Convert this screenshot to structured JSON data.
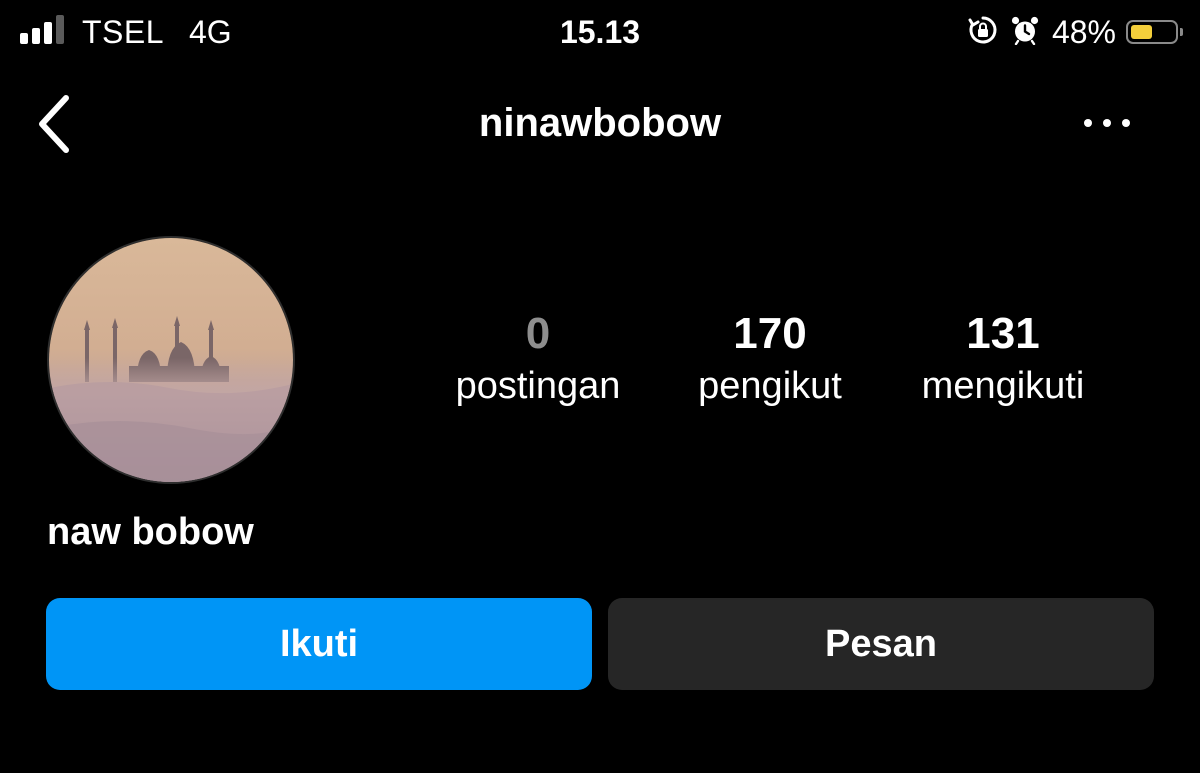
{
  "status_bar": {
    "carrier": "TSEL",
    "network": "4G",
    "time": "15.13",
    "battery_percent_label": "48%",
    "battery_level": 0.48,
    "battery_color": "#f4cf3b",
    "icons": [
      "signal-icon",
      "rotation-lock-icon",
      "alarm-icon",
      "battery-icon"
    ]
  },
  "header": {
    "username": "ninawbobow",
    "back_icon": "chevron-left-icon",
    "more_icon": "more-horizontal-icon"
  },
  "profile": {
    "display_name": "naw bobow",
    "stats": {
      "posts": {
        "value": "0",
        "label": "postingan"
      },
      "followers": {
        "value": "170",
        "label": "pengikut"
      },
      "following": {
        "value": "131",
        "label": "mengikuti"
      }
    }
  },
  "actions": {
    "follow_label": "Ikuti",
    "message_label": "Pesan",
    "follow_color": "#0095f6",
    "message_color": "#262626"
  }
}
